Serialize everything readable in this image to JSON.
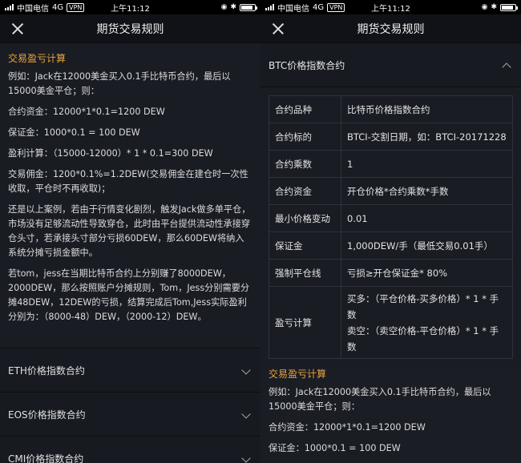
{
  "status": {
    "carrier": "中国电信",
    "network": "4G",
    "vpn": "VPN",
    "time": "上午11:12",
    "orientation_icon": "rotation-lock-icon",
    "bt_icon": "bluetooth-icon"
  },
  "header": {
    "title": "期货交易规则"
  },
  "left": {
    "section_title": "交易盈亏计算",
    "paragraphs": {
      "p1": "例如：Jack在12000美金买入0.1手比特币合约，最后以15000美金平仓；则：",
      "p2": "合约资金：12000*1*0.1=1200 DEW",
      "p3": "保证金：1000*0.1 = 100 DEW",
      "p4": "盈利计算：（15000-12000）* 1 * 0.1=300 DEW",
      "p5": "交易佣金：1200*0.1%=1.2DEW(交易佣金在建仓时一次性收取，平仓时不再收取)；",
      "p6": "还是以上案例，若由于行情变化剧烈，触发Jack做多单平仓，市场没有足够流动性导致穿仓，此时由平台提供流动性承接穿仓头寸，若承接头寸部分亏损60DEW，那么60DEW将纳入系统分摊亏损金额中。",
      "p7": "若tom，jess在当期比特币合约上分别赚了8000DEW，2000DEW，那么按照账户分摊规则，Tom，Jess分别需要分摊48DEW，12DEW的亏损，结算完成后Tom,Jess实际盈利分别为：（8000-48）DEW，（2000-12）DEW。"
    },
    "accordion": [
      "ETH价格指数合约",
      "EOS价格指数合约",
      "CMI价格指数合约"
    ]
  },
  "right": {
    "section_header": "BTC价格指数合约",
    "table": [
      {
        "k": "合约品种",
        "v": "比特币价格指数合约"
      },
      {
        "k": "合约标的",
        "v": "BTCI-交割日期，如：BTCI-20171228"
      },
      {
        "k": "合约乘数",
        "v": "1"
      },
      {
        "k": "合约资金",
        "v": "开仓价格*合约乘数*手数"
      },
      {
        "k": "最小价格变动",
        "v": "0.01"
      },
      {
        "k": "保证金",
        "v": "1,000DEW/手（最低交易0.01手）"
      },
      {
        "k": "强制平仓线",
        "v": "亏损≥开仓保证金* 80%"
      },
      {
        "k": "盈亏计算",
        "v1": "买多：（平仓价格-买多价格）* 1 * 手数",
        "v2": "卖空：（卖空价格-平仓价格）* 1 * 手数"
      }
    ],
    "section_title": "交易盈亏计算",
    "p1": "例如：Jack在12000美金买入0.1手比特币合约，最后以15000美金平仓；则：",
    "p2": "合约资金：12000*1*0.1=1200 DEW",
    "p3": "保证金：1000*0.1 = 100 DEW"
  }
}
